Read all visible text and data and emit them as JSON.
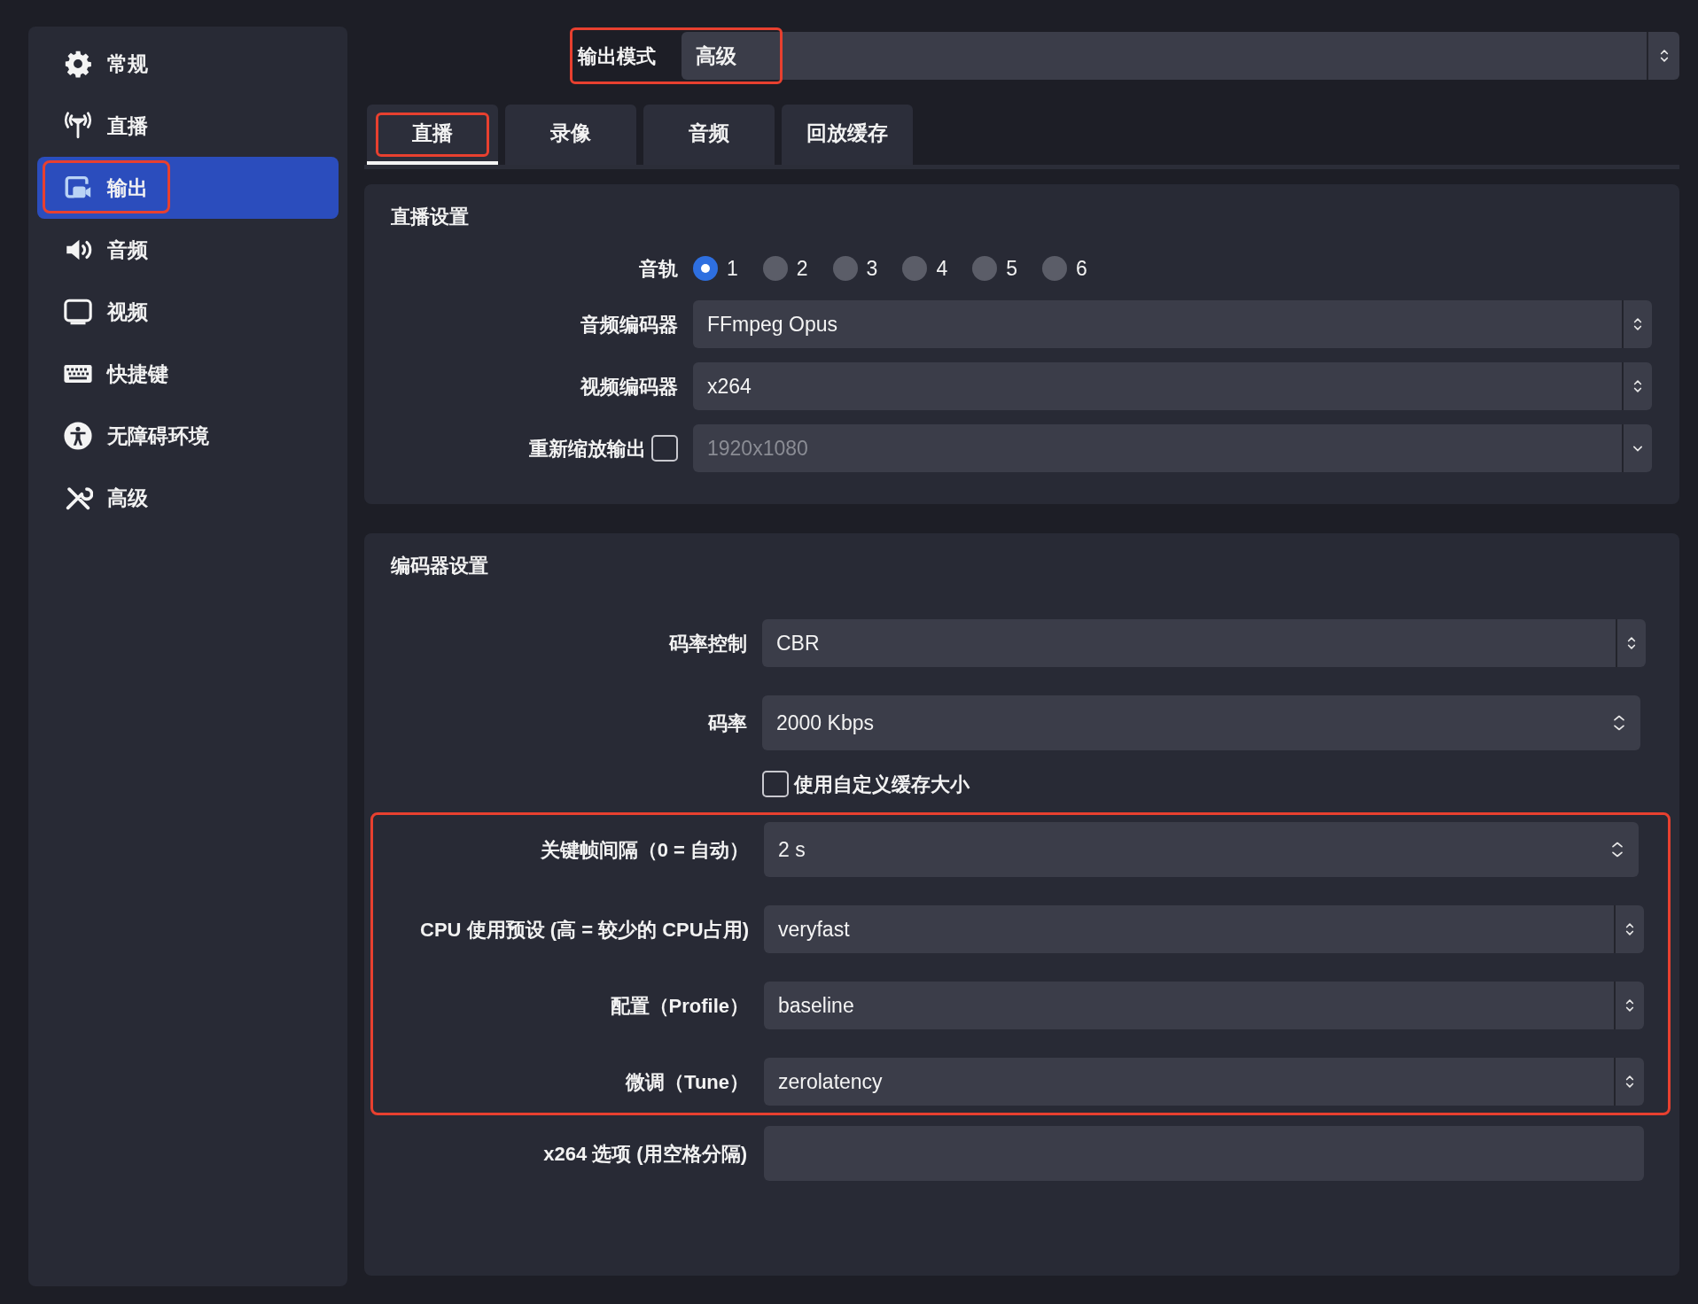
{
  "sidebar": {
    "items": [
      {
        "label": "常规",
        "selected": false,
        "highlighted": false
      },
      {
        "label": "直播",
        "selected": false,
        "highlighted": false
      },
      {
        "label": "输出",
        "selected": true,
        "highlighted": true
      },
      {
        "label": "音频",
        "selected": false,
        "highlighted": false
      },
      {
        "label": "视频",
        "selected": false,
        "highlighted": false
      },
      {
        "label": "快捷键",
        "selected": false,
        "highlighted": false
      },
      {
        "label": "无障碍环境",
        "selected": false,
        "highlighted": false
      },
      {
        "label": "高级",
        "selected": false,
        "highlighted": false
      }
    ]
  },
  "output_mode": {
    "label": "输出模式",
    "value": "高级",
    "highlighted": true
  },
  "tabs": [
    {
      "label": "直播",
      "selected": true,
      "highlighted": true
    },
    {
      "label": "录像",
      "selected": false,
      "highlighted": false
    },
    {
      "label": "音频",
      "selected": false,
      "highlighted": false
    },
    {
      "label": "回放缓存",
      "selected": false,
      "highlighted": false
    }
  ],
  "stream_settings": {
    "title": "直播设置",
    "audio_track": {
      "label": "音轨",
      "options": [
        {
          "label": "1",
          "selected": true
        },
        {
          "label": "2",
          "selected": false
        },
        {
          "label": "3",
          "selected": false
        },
        {
          "label": "4",
          "selected": false
        },
        {
          "label": "5",
          "selected": false
        },
        {
          "label": "6",
          "selected": false
        }
      ]
    },
    "fields": [
      {
        "kind": "select",
        "label": "音频编码器",
        "value": "FFmpeg Opus"
      },
      {
        "kind": "select",
        "label": "视频编码器",
        "value": "x264"
      },
      {
        "kind": "checked_select",
        "label": "重新缩放输出",
        "checked": false,
        "value": "1920x1080",
        "disabled": true
      }
    ]
  },
  "encoder_settings": {
    "title": "编码器设置",
    "fields": [
      {
        "kind": "select",
        "label": "码率控制",
        "value": "CBR",
        "highlighted": false
      },
      {
        "kind": "spinbox",
        "label": "码率",
        "value": "2000 Kbps",
        "highlighted": false
      },
      {
        "kind": "checkbox",
        "label": "使用自定义缓存大小",
        "checked": false,
        "highlighted": false
      },
      {
        "kind": "spinbox",
        "label": "关键帧间隔（0 = 自动）",
        "value": "2 s",
        "highlighted": true
      },
      {
        "kind": "select",
        "label": "CPU 使用预设 (高 = 较少的 CPU占用)",
        "value": "veryfast",
        "highlighted": true
      },
      {
        "kind": "select",
        "label": "配置（Profile）",
        "value": "baseline",
        "highlighted": true
      },
      {
        "kind": "select",
        "label": "微调（Tune）",
        "value": "zerolatency",
        "highlighted": true
      },
      {
        "kind": "text",
        "label": "x264 选项 (用空格分隔)",
        "highlighted": false
      }
    ]
  }
}
